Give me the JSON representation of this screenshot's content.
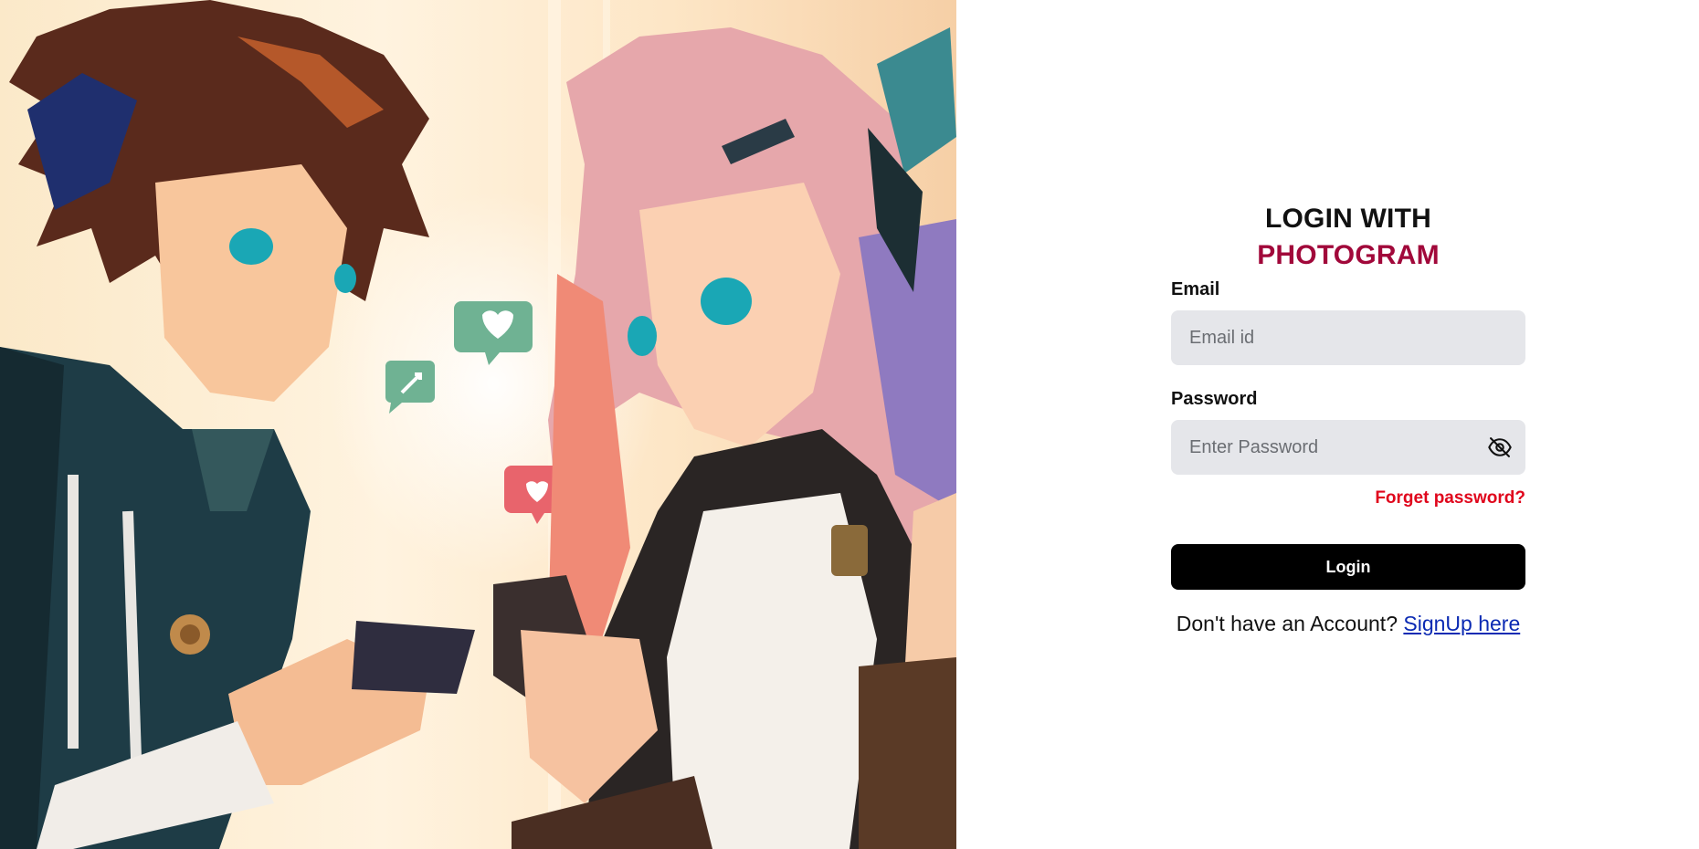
{
  "hero": {
    "image": "anime-couple-with-phones-illustration"
  },
  "login": {
    "title_prefix": "LOGIN WITH",
    "title_brand": "PHOTOGRAM",
    "email_label": "Email",
    "email_placeholder": "Email id",
    "email_value": "",
    "password_label": "Password",
    "password_placeholder": "Enter Password",
    "password_value": "",
    "password_toggle_icon": "eye-slash-icon",
    "forgot_label": "Forget password?",
    "login_button": "Login",
    "signup_prompt": "Don't have an Account?",
    "signup_link": "SignUp here"
  },
  "colors": {
    "brand": "#a1083a",
    "forgot": "#e0061c",
    "link": "#0b2ab3",
    "button_bg": "#000000",
    "field_bg": "#e5e6ea"
  }
}
